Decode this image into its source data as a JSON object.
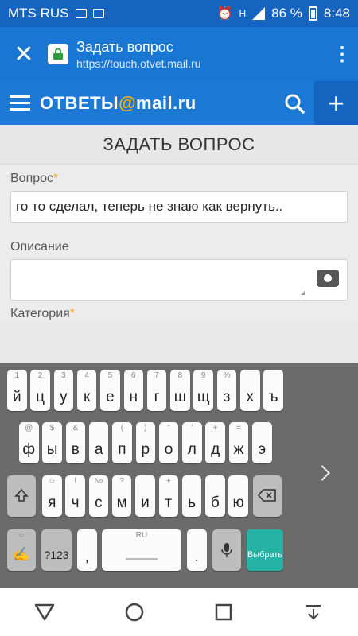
{
  "status": {
    "carrier": "MTS RUS",
    "battery": "86 %",
    "time": "8:48",
    "network": "H"
  },
  "browser": {
    "title": "Задать вопрос",
    "url": "https://touch.otvet.mail.ru"
  },
  "site": {
    "logo_prefix": "ОТВЕТЫ",
    "logo_at": "@",
    "logo_suffix": "mail.ru"
  },
  "page": {
    "title": "ЗАДАТЬ ВОПРОС",
    "question_label": "Вопрос",
    "question_value": "го то сделал, теперь не знаю как вернуть..",
    "description_label": "Описание",
    "category_label": "Категория",
    "required_mark": "*"
  },
  "keyboard": {
    "row1": [
      [
        "й",
        "1"
      ],
      [
        "ц",
        "2"
      ],
      [
        "у",
        "3"
      ],
      [
        "к",
        "4"
      ],
      [
        "е",
        "5"
      ],
      [
        "н",
        "6"
      ],
      [
        "г",
        "7"
      ],
      [
        "ш",
        "8"
      ],
      [
        "щ",
        "9"
      ],
      [
        "з",
        "%"
      ],
      [
        "х",
        ""
      ],
      [
        "ъ",
        ""
      ]
    ],
    "row2": [
      [
        "ф",
        "@"
      ],
      [
        "ы",
        "$"
      ],
      [
        "в",
        "&"
      ],
      [
        "а",
        ""
      ],
      [
        "п",
        "("
      ],
      [
        "р",
        ")"
      ],
      [
        "о",
        "\""
      ],
      [
        "л",
        "'"
      ],
      [
        "д",
        "+"
      ],
      [
        "ж",
        "="
      ],
      [
        "э",
        ""
      ]
    ],
    "row3": [
      [
        "я",
        "☺"
      ],
      [
        "ч",
        "!"
      ],
      [
        "с",
        "№"
      ],
      [
        "м",
        "?"
      ],
      [
        "и",
        ""
      ],
      [
        "т",
        "+"
      ],
      [
        "ь",
        ""
      ],
      [
        "б",
        ""
      ],
      [
        "ю",
        ""
      ]
    ],
    "symbols_label": "?123",
    "comma": ",",
    "period": ".",
    "space_lang": "RU",
    "action_label": "Выбрать"
  },
  "colors": {
    "statusbar": "#1565c0",
    "header": "#1976d2",
    "accent": "#f5a623",
    "action": "#26b3a6"
  }
}
